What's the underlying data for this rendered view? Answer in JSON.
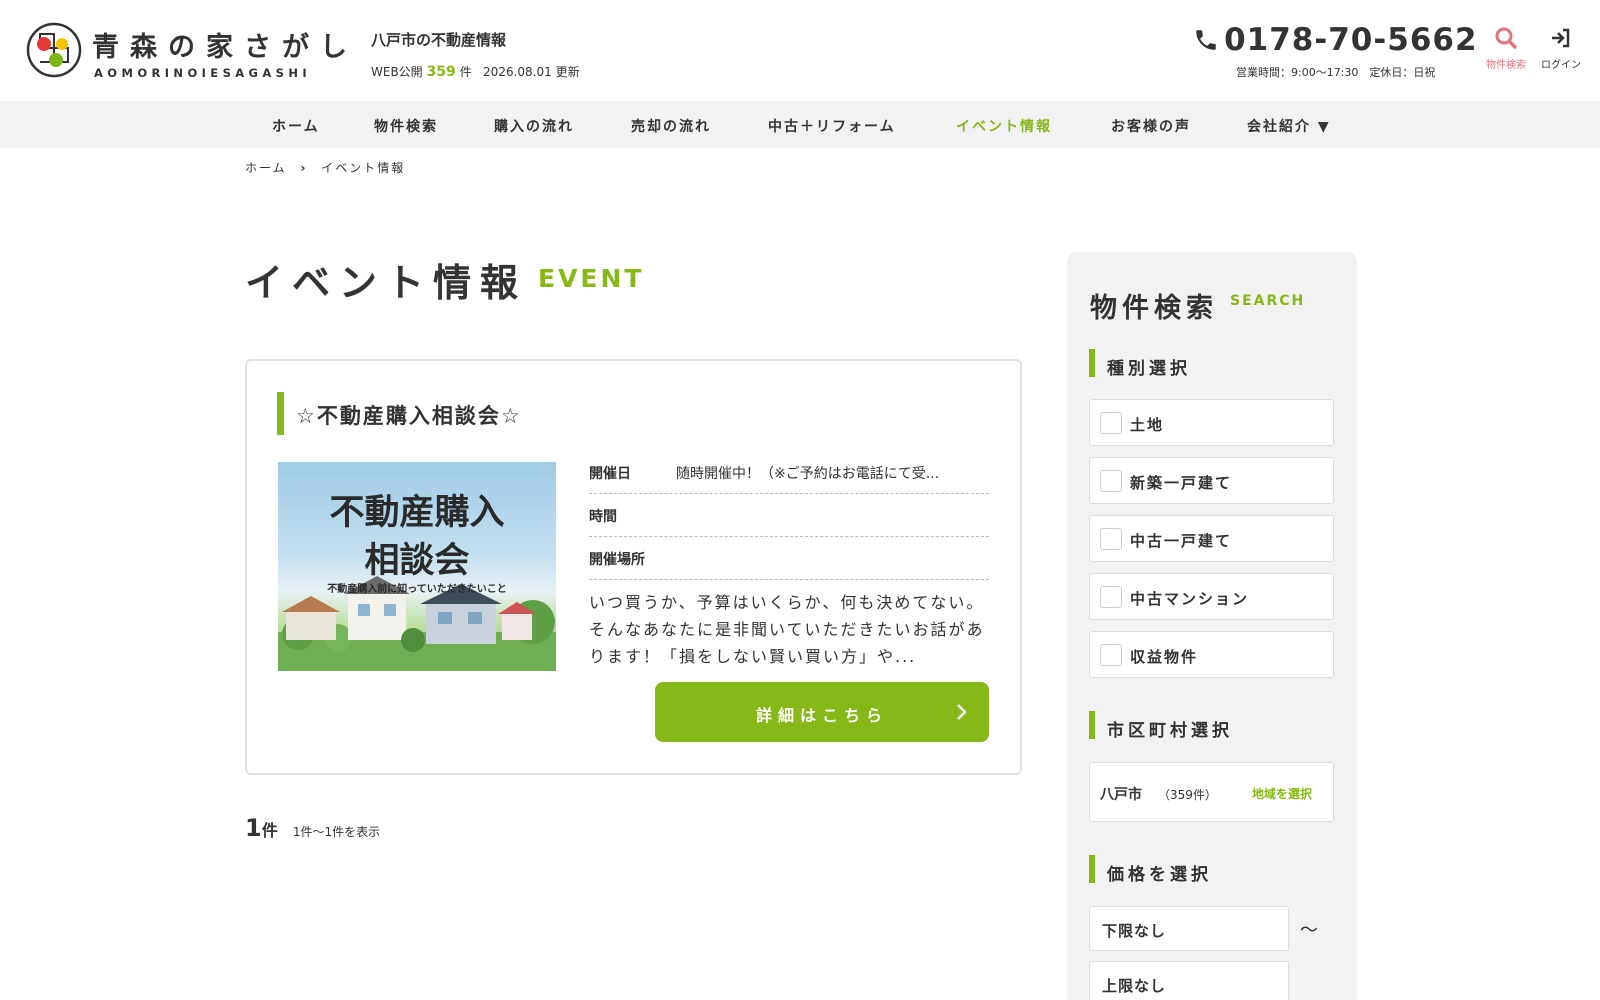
{
  "header": {
    "logo_jp": "青森の家さがし",
    "logo_en": "AOMORINOIESAGASHI",
    "site_subtitle": "八戸市の不動産情報",
    "web_public_prefix": "WEB公開",
    "web_public_count": "359",
    "web_public_unit": "件",
    "updated_date": "2026.08.01",
    "updated_label": "更新",
    "phone": "0178-70-5662",
    "hours": "営業時間：9:00〜17:30　定休日：日祝",
    "search_label": "物件検索",
    "login_label": "ログイン",
    "icons": {
      "phone": "phone-icon",
      "search": "search-icon",
      "login": "login-icon"
    },
    "accent_search": "#e5737d"
  },
  "nav": {
    "items": [
      {
        "label": "ホーム"
      },
      {
        "label": "物件検索"
      },
      {
        "label": "購入の流れ"
      },
      {
        "label": "売却の流れ"
      },
      {
        "label": "中古＋リフォーム"
      },
      {
        "label": "イベント情報",
        "active": true
      },
      {
        "label": "お客様の声"
      },
      {
        "label": "会社紹介 ▼"
      }
    ]
  },
  "breadcrumb": {
    "home": "ホーム",
    "current": "イベント情報"
  },
  "page": {
    "title": "イベント情報",
    "title_en": "EVENT"
  },
  "event": {
    "title": "☆不動産購入相談会☆",
    "thumb_line1": "不動産購入",
    "thumb_line2": "相談会",
    "thumb_sub": "不動産購入前に知っていただきたいこと",
    "rows": [
      {
        "label": "開催日",
        "value": "随時開催中！（※ご予約はお電話にて受..."
      },
      {
        "label": "時間",
        "value": ""
      },
      {
        "label": "開催場所",
        "value": ""
      }
    ],
    "description": "いつ買うか、予算はいくらか、何も決めてない。 そんなあなたに是非聞いていただきたいお話があります！「損をしない賢い買い方」や...",
    "detail_button": "詳細はこちら"
  },
  "results": {
    "count": "1",
    "unit": "件",
    "range": "1件〜1件を表示"
  },
  "sidebar": {
    "title": "物件検索",
    "title_en": "SEARCH",
    "type_section": "種別選択",
    "types": [
      "土地",
      "新築一戸建て",
      "中古一戸建て",
      "中古マンション",
      "収益物件"
    ],
    "city_section": "市区町村選択",
    "city_name": "八戸市",
    "city_count": "（359件）",
    "city_select": "地域を選択",
    "price_section": "価格を選択",
    "price_min": "下限なし",
    "price_max": "上限なし",
    "tilde": "〜"
  },
  "colors": {
    "accent": "#86b817",
    "nav_bg": "#f2f2f2",
    "sidebar_bg": "#f2f2f2"
  }
}
